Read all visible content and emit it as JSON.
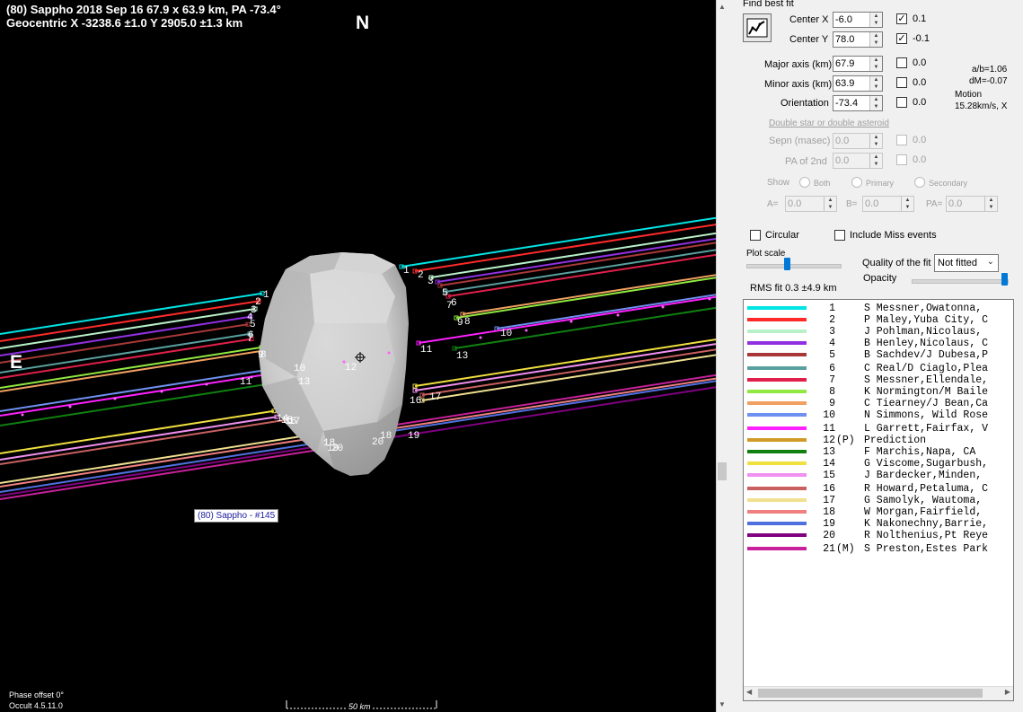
{
  "header": {
    "line1": "(80) Sappho  2018 Sep 16  67.9 x 63.9 km, PA -73.4°",
    "line2": "Geocentric  X  -3238.6 ±1.0  Y 2905.0 ±1.3 km"
  },
  "plot": {
    "north_label": "N",
    "east_label": "E",
    "tooltip": "(80) Sappho - #145",
    "scale_label": "50 km",
    "phase_offset": "Phase offset 0°",
    "version": "Occult 4.5.11.0",
    "chord_labels": [
      {
        "text": "1",
        "side": "a"
      },
      {
        "text": "2",
        "side": "a"
      },
      {
        "text": "3",
        "side": "a"
      },
      {
        "text": "4",
        "side": "a"
      },
      {
        "text": "5",
        "side": "a"
      },
      {
        "text": "6",
        "side": "a"
      },
      {
        "text": "7",
        "side": "a"
      },
      {
        "text": "8",
        "side": "a"
      },
      {
        "text": "9",
        "side": "a"
      },
      {
        "text": "10",
        "side": "a"
      },
      {
        "text": "11",
        "side": "a"
      },
      {
        "text": "12",
        "side": "a"
      },
      {
        "text": "13",
        "side": "a"
      },
      {
        "text": "14",
        "side": "a"
      },
      {
        "text": "15",
        "side": "a"
      },
      {
        "text": "16",
        "side": "a"
      },
      {
        "text": "17",
        "side": "a"
      },
      {
        "text": "18",
        "side": "a"
      },
      {
        "text": "19",
        "side": "a"
      },
      {
        "text": "20",
        "side": "a"
      },
      {
        "text": "1",
        "side": "b"
      },
      {
        "text": "2",
        "side": "b"
      },
      {
        "text": "3",
        "side": "b"
      },
      {
        "text": "5",
        "side": "b"
      },
      {
        "text": "6",
        "side": "b"
      },
      {
        "text": "7",
        "side": "b"
      },
      {
        "text": "9",
        "side": "b"
      },
      {
        "text": "8",
        "side": "b"
      },
      {
        "text": "10",
        "side": "b"
      },
      {
        "text": "11",
        "side": "b"
      },
      {
        "text": "13",
        "side": "b"
      },
      {
        "text": "16",
        "side": "b"
      },
      {
        "text": "17",
        "side": "b"
      },
      {
        "text": "18",
        "side": "b"
      },
      {
        "text": "19",
        "side": "b"
      },
      {
        "text": "20",
        "side": "b"
      }
    ]
  },
  "panel": {
    "find_best_fit": "Find best fit",
    "center_x": {
      "label": "Center X",
      "value": "-6.0",
      "checked": true,
      "step": "0.1"
    },
    "center_y": {
      "label": "Center Y",
      "value": "78.0",
      "checked": true,
      "step": "-0.1"
    },
    "major_axis": {
      "label": "Major axis (km)",
      "value": "67.9",
      "checked": false,
      "step": "0.0"
    },
    "minor_axis": {
      "label": "Minor axis (km)",
      "value": "63.9",
      "checked": false,
      "step": "0.0"
    },
    "orientation": {
      "label": "Orientation",
      "value": "-73.4",
      "checked": false,
      "step": "0.0"
    },
    "ratio": "a/b=1.06",
    "dm": "dM=-0.07",
    "motion_label": "Motion",
    "motion_value": "15.28km/s, X",
    "double_star": "Double star  or  double asteroid",
    "sepn": {
      "label": "Sepn (masec)",
      "value": "0.0",
      "step": "0.0"
    },
    "pa2": {
      "label": "PA of 2nd",
      "value": "0.0",
      "step": "0.0"
    },
    "show_label": "Show",
    "show_options": [
      "Both",
      "Primary",
      "Secondary"
    ],
    "a_eq": {
      "label": "A=",
      "value": "0.0"
    },
    "b_eq": {
      "label": "B=",
      "value": "0.0"
    },
    "pa_eq": {
      "label": "PA=",
      "value": "0.0"
    },
    "circular": "Circular",
    "include_miss": "Include Miss events",
    "plot_scale": "Plot scale",
    "quality_label": "Quality of the fit",
    "quality_value": "Not fitted",
    "opacity_label": "Opacity",
    "rms": "RMS fit 0.3 ±4.9 km"
  },
  "legend": [
    {
      "num": "1",
      "flag": "",
      "name": "S Messner,Owatonna,",
      "color": "#00e5e5"
    },
    {
      "num": "2",
      "flag": "",
      "name": "P Maley,Yuba City, C",
      "color": "#ff2a2a"
    },
    {
      "num": "3",
      "flag": "",
      "name": "J Pohlman,Nicolaus,",
      "color": "#b8f0c8"
    },
    {
      "num": "4",
      "flag": "",
      "name": "B Henley,Nicolaus, C",
      "color": "#9030e0"
    },
    {
      "num": "5",
      "flag": "",
      "name": "B Sachdev/J Dubesa,P",
      "color": "#a83838"
    },
    {
      "num": "6",
      "flag": "",
      "name": "C Real/D Ciaglo,Plea",
      "color": "#5aa0a0"
    },
    {
      "num": "7",
      "flag": "",
      "name": "S Messner,Ellendale,",
      "color": "#e0204a"
    },
    {
      "num": "8",
      "flag": "",
      "name": "K Normington/M Baile",
      "color": "#90e840"
    },
    {
      "num": "9",
      "flag": "",
      "name": "C Tiearney/J Bean,Ca",
      "color": "#f0a060"
    },
    {
      "num": "10",
      "flag": "",
      "name": "N Simmons, Wild Rose",
      "color": "#6e90f0"
    },
    {
      "num": "11",
      "flag": "",
      "name": "L Garrett,Fairfax, V",
      "color": "#ff20ff"
    },
    {
      "num": "12",
      "flag": "(P)",
      "name": "Prediction",
      "color": "#d09a28"
    },
    {
      "num": "13",
      "flag": "",
      "name": "F Marchis,Napa, CA",
      "color": "#108010"
    },
    {
      "num": "14",
      "flag": "",
      "name": "G Viscome,Sugarbush,",
      "color": "#f0e040"
    },
    {
      "num": "15",
      "flag": "",
      "name": "J Bardecker,Minden,",
      "color": "#f090f0"
    },
    {
      "num": "16",
      "flag": "",
      "name": "R Howard,Petaluma, C",
      "color": "#c86060"
    },
    {
      "num": "17",
      "flag": "",
      "name": "G Samolyk, Wautoma,",
      "color": "#f0e090"
    },
    {
      "num": "18",
      "flag": "",
      "name": "W Morgan,Fairfield,",
      "color": "#f08080"
    },
    {
      "num": "19",
      "flag": "",
      "name": "K Nakonechny,Barrie,",
      "color": "#5070e0"
    },
    {
      "num": "20",
      "flag": "",
      "name": "R Nolthenius,Pt Reye",
      "color": "#800080"
    },
    {
      "num": "21",
      "flag": "(M)",
      "name": "S Preston,Estes Park",
      "color": "#c8209a"
    }
  ]
}
